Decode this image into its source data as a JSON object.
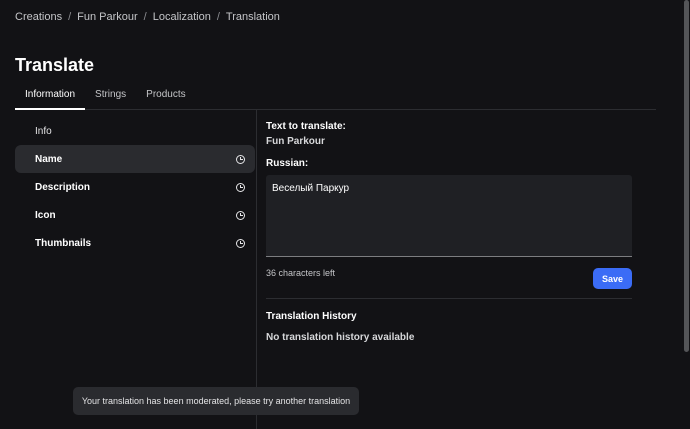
{
  "breadcrumb": {
    "items": [
      "Creations",
      "Fun Parkour",
      "Localization",
      "Translation"
    ],
    "separator": "/"
  },
  "page": {
    "title": "Translate"
  },
  "tabs": [
    {
      "label": "Information",
      "active": true
    },
    {
      "label": "Strings",
      "active": false
    },
    {
      "label": "Products",
      "active": false
    }
  ],
  "sidebar": {
    "items": [
      {
        "label": "Info",
        "icon": "",
        "active": false
      },
      {
        "label": "Name",
        "icon": "clock-icon",
        "active": true
      },
      {
        "label": "Description",
        "icon": "clock-icon",
        "active": false
      },
      {
        "label": "Icon",
        "icon": "clock-icon",
        "active": false
      },
      {
        "label": "Thumbnails",
        "icon": "clock-icon",
        "active": false
      }
    ]
  },
  "translate": {
    "source_label": "Text to translate:",
    "source_value": "Fun Parkour",
    "target_label": "Russian:",
    "target_value": "Веселый Паркур",
    "chars_left": "36 characters left",
    "save_label": "Save"
  },
  "history": {
    "title": "Translation History",
    "empty_text": "No translation history available"
  },
  "toast": {
    "message": "Your translation has been moderated, please try another translation"
  },
  "colors": {
    "background": "#121215",
    "accent": "#3b6cf6",
    "active_row": "#2a2b2f"
  }
}
